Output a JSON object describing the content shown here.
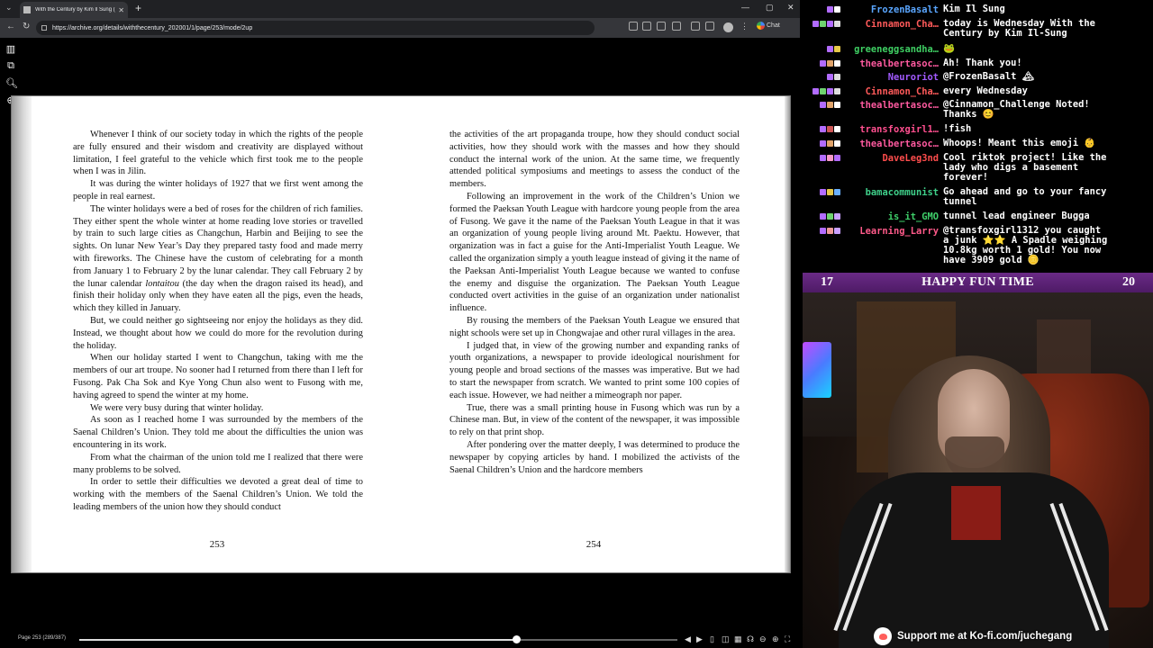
{
  "browser": {
    "tab_title": "With the Century by Kim Il Sung (E",
    "url": "https://archive.org/details/withthecentury_202001/1/page/253/mode/2up",
    "chat_label": "Chat"
  },
  "reader": {
    "left_page": {
      "paragraphs": [
        "Whenever I think of our society today in which the rights of the people are fully ensured and their wisdom and creativity are displayed without limitation, I feel grateful to the vehicle which first took me to the people when I was in Jilin.",
        "It was during the winter holidays of 1927 that we first went among the people in real earnest.",
        "The winter holidays were a bed of roses for the children of rich families. They either spent the whole winter at home reading love stories or travelled by train to such large cities as Changchun, Harbin and Beijing to see the sights. On lunar New Year’s Day they prepared tasty food and made merry with fireworks. The Chinese have the custom of celebrating for a month from January 1 to February 2 by the lunar calendar. They call February 2 by the lunar calendar lontaitou (the day when the dragon raised its head), and finish their holiday only when they have eaten all the pigs, even the heads, which they killed in January.",
        "But, we could neither go sightseeing nor enjoy the holidays as they did. Instead, we thought about how we could do more for the revolution during the holiday.",
        "When our holiday started I went to Changchun, taking with me the members of our art troupe. No sooner had I returned from there than I left for Fusong. Pak Cha Sok and Kye Yong Chun also went to Fusong with me, having agreed to spend the winter at my home.",
        "We were very busy during that winter holiday.",
        "As soon as I reached home I was surrounded by the members of the Saenal Children’s Union. They told me about the difficulties the union was encountering in its work.",
        "From what the chairman of the union told me I realized that there were many problems to be solved.",
        "In order to settle their difficulties we devoted a great deal of time to working with the members of the Saenal Children’s Union. We told the leading members of the union how they should conduct"
      ],
      "page_number": "253"
    },
    "right_page": {
      "paragraphs": [
        "the activities of the art propaganda troupe, how they should conduct social activities, how they should work with the masses and how they should conduct the internal work of the union. At the same time, we frequently attended political symposiums and meetings to assess the conduct of the members.",
        "Following an improvement in the work of the Children’s Union we formed the Paeksan Youth League with hardcore young people from the area of Fusong. We gave it the name of the Paeksan Youth League in that it was an organization of young people living around Mt. Paektu. However, that organization was in fact a guise for the Anti-Imperialist Youth League. We called the organization simply a youth league instead of giving it the name of the Paeksan Anti-Imperialist Youth League because we wanted to confuse the enemy and disguise the organization. The Paeksan Youth League conducted overt activities in the guise of an organization under nationalist influence.",
        "By rousing the members of the Paeksan Youth League we ensured that night schools were set up in Chongwajae and other rural villages in the area.",
        "I judged that, in view of the growing number and expanding ranks of youth organizations, a newspaper to provide ideological nourishment for young people and broad sections of the masses was imperative. But we had to start the newspaper from scratch. We wanted to print some 100 copies of each issue. However, we had neither a mimeograph nor paper.",
        "True, there was a small printing house in Fusong which was run by a Chinese man. But, in view of the content of the newspaper, it was impossible to rely on that print shop.",
        "After pondering over the matter deeply, I was determined to produce the newspaper by copying articles by hand. I mobilized the activists of the Saenal Children’s Union and the hardcore members"
      ],
      "page_number": "254"
    },
    "page_info": "Page 253 (289/387)",
    "progress": 0.73
  },
  "chat": {
    "messages": [
      {
        "user": "FrozenBasalt",
        "color": "#5aa6ff",
        "text": "Kim Il Sung",
        "badges": [
          "#b26cff",
          "#fff"
        ]
      },
      {
        "user": "Cinnamon_Cha…",
        "color": "#ff5a5a",
        "text": "today is Wednesday With the\nCentury by Kim Il-Sung",
        "badges": [
          "#b26cff",
          "#6fd36f",
          "#b26cff",
          "#ddd"
        ]
      },
      {
        "user": "greeneggsandha…",
        "color": "#3fcf63",
        "text": "🐸",
        "badges": [
          "#b26cff",
          "#e6c84a"
        ]
      },
      {
        "user": "thealbertasoc…",
        "color": "#ff5aa0",
        "text": "Ah! Thank you!",
        "badges": [
          "#b26cff",
          "#e0a36a",
          "#fff"
        ]
      },
      {
        "user": "Neuroriot",
        "color": "#a25aff",
        "text": "@FrozenBasalt 🏔",
        "badges": [
          "#b26cff",
          "#ddd"
        ]
      },
      {
        "user": "Cinnamon_Cha…",
        "color": "#ff5a5a",
        "text": "every Wednesday",
        "badges": [
          "#b26cff",
          "#6fd36f",
          "#b26cff",
          "#ddd"
        ]
      },
      {
        "user": "thealbertasoc…",
        "color": "#ff5aa0",
        "text": "@Cinnamon_Challenge Noted!\nThanks 😊",
        "badges": [
          "#b26cff",
          "#e0a36a",
          "#fff"
        ]
      },
      {
        "user": "transfoxgirl1…",
        "color": "#ff4f8f",
        "text": "!fish",
        "badges": [
          "#b26cff",
          "#c55",
          "#fff"
        ]
      },
      {
        "user": "thealbertasoc…",
        "color": "#ff5aa0",
        "text": "Whoops! Meant this emoji 👶",
        "badges": [
          "#b26cff",
          "#e0a36a",
          "#fff"
        ]
      },
      {
        "user": "DaveLeg3nd",
        "color": "#ff4d4d",
        "text": "Cool riktok project! Like the\nlady who digs a basement\nforever!",
        "badges": [
          "#b26cff",
          "#f59ac8",
          "#b26cff"
        ]
      },
      {
        "user": "bamacommunist",
        "color": "#3fd08a",
        "text": "Go ahead and go to your fancy\ntunnel",
        "badges": [
          "#b26cff",
          "#e6c84a",
          "#6ab0ff"
        ]
      },
      {
        "user": "is_it_GMO",
        "color": "#3fd06a",
        "text": "tunnel lead engineer Bugga",
        "badges": [
          "#b26cff",
          "#6fd36f",
          "#c9a0ff"
        ]
      },
      {
        "user": "Learning_Larry",
        "color": "#ff5a8a",
        "text": "@transfoxgirl1312 you caught\na junk ⭐⭐ A Spadle weighing\n10.8kg worth 1 gold! You now\nhave 3909 gold 🪙",
        "badges": [
          "#b26cff",
          "#e99",
          "#c9a0ff"
        ]
      }
    ]
  },
  "overlay": {
    "left_num": "17",
    "title": "HAPPY FUN TIME",
    "right_num": "20",
    "kofi": "Support me at Ko-fi.com/juchegang"
  }
}
